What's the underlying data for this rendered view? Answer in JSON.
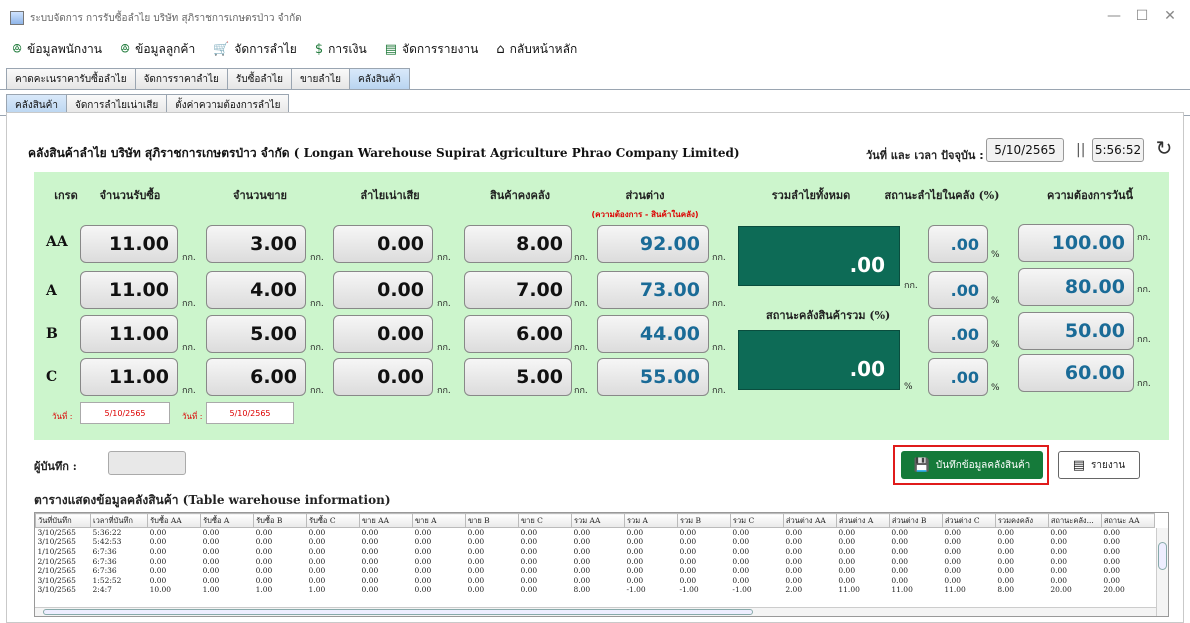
{
  "window": {
    "title": "ระบบจัดการ การรับซื้อลำไย บริษัท สุภิราชการเกษตรป่าว จำกัด"
  },
  "menu": [
    {
      "label": "ข้อมูลพนักงาน",
      "icon": "people-icon"
    },
    {
      "label": "ข้อมูลลูกค้า",
      "icon": "people-icon"
    },
    {
      "label": "จัดการลำไย",
      "icon": "cart-icon"
    },
    {
      "label": "การเงิน",
      "icon": "dollar-icon"
    },
    {
      "label": "จัดการรายงาน",
      "icon": "document-icon"
    },
    {
      "label": "กลับหน้าหลัก",
      "icon": "home-icon"
    }
  ],
  "tabs_main": [
    "คาดคะเนราคารับซื้อลำไย",
    "จัดการราคาลำไย",
    "รับซื้อลำไย",
    "ขายลำไย",
    "คลังสินค้า"
  ],
  "tabs_sub": [
    "คลังสินค้า",
    "จัดการลำไยเน่าเสีย",
    "ตั้งค่าความต้องการลำไย"
  ],
  "heading": "คลังสินค้าลำไย บริษัท สุภิราชการเกษตรป่าว จำกัด ( Longan Warehouse Supirat Agriculture Phrao Company Limited)",
  "datetime": {
    "label": "วันที่ และ เวลา ปัจจุบัน :",
    "date": "5/10/2565",
    "time": "5:56:52",
    "separator": "||"
  },
  "columns": {
    "grade": "เกรด",
    "purchase": "จำนวนรับซื้อ",
    "sold": "จำนวนขาย",
    "spoiled": "ลำไยเน่าเสีย",
    "stock": "สินค้าคงคลัง",
    "diff": "ส่วนต่าง",
    "diff_note": "(ความต้องการ - สินค้าในคลัง)",
    "total": "รวมลำไยทั้งหมด",
    "status": "สถานะลำไยในคลัง (%)",
    "demand": "ความต้องการวันนี้"
  },
  "unit": "กก.",
  "percent": "%",
  "grades": [
    {
      "grade": "AA",
      "purchase": "11.00",
      "sold": "3.00",
      "spoiled": "0.00",
      "stock": "8.00",
      "diff": "92.00",
      "status": ".00",
      "demand": "100.00"
    },
    {
      "grade": "A",
      "purchase": "11.00",
      "sold": "4.00",
      "spoiled": "0.00",
      "stock": "7.00",
      "diff": "73.00",
      "status": ".00",
      "demand": "80.00"
    },
    {
      "grade": "B",
      "purchase": "11.00",
      "sold": "5.00",
      "spoiled": "0.00",
      "stock": "6.00",
      "diff": "44.00",
      "status": ".00",
      "demand": "50.00"
    },
    {
      "grade": "C",
      "purchase": "11.00",
      "sold": "6.00",
      "spoiled": "0.00",
      "stock": "5.00",
      "diff": "55.00",
      "status": ".00",
      "demand": "60.00"
    }
  ],
  "total_value": ".00",
  "overall_label": "สถานะคลังสินค้ารวม (%)",
  "overall_value": ".00",
  "date_rows": {
    "label1": "วันที่ :",
    "date1": "5/10/2565",
    "label2": "วันที่ :",
    "date2": "5/10/2565"
  },
  "recorder_label": "ผู้บันทึก :",
  "buttons": {
    "save": "บันทึกข้อมูลคลังสินค้า",
    "report": "รายงาน"
  },
  "table": {
    "caption": "ตารางแสดงข้อมูลคลังสินค้า (Table warehouse information)",
    "headers": [
      "วันที่บันทึก",
      "เวลาที่บันทึก",
      "รับซื้อ AA",
      "รับซื้อ A",
      "รับซื้อ B",
      "รับซื้อ C",
      "ขาย AA",
      "ขาย A",
      "ขาย B",
      "ขาย C",
      "รวม AA",
      "รวม A",
      "รวม B",
      "รวม C",
      "ส่วนต่าง AA",
      "ส่วนต่าง A",
      "ส่วนต่าง B",
      "ส่วนต่าง C",
      "รวมคงคลัง",
      "สถานะคลัง...",
      "สถานะ AA"
    ],
    "rows": [
      [
        "3/10/2565",
        "5:36:22",
        "0.00",
        "0.00",
        "0.00",
        "0.00",
        "0.00",
        "0.00",
        "0.00",
        "0.00",
        "0.00",
        "0.00",
        "0.00",
        "0.00",
        "0.00",
        "0.00",
        "0.00",
        "0.00",
        "0.00",
        "0.00",
        "0.00"
      ],
      [
        "3/10/2565",
        "5:42:53",
        "0.00",
        "0.00",
        "0.00",
        "0.00",
        "0.00",
        "0.00",
        "0.00",
        "0.00",
        "0.00",
        "0.00",
        "0.00",
        "0.00",
        "0.00",
        "0.00",
        "0.00",
        "0.00",
        "0.00",
        "0.00",
        "0.00"
      ],
      [
        "1/10/2565",
        "6:7:36",
        "0.00",
        "0.00",
        "0.00",
        "0.00",
        "0.00",
        "0.00",
        "0.00",
        "0.00",
        "0.00",
        "0.00",
        "0.00",
        "0.00",
        "0.00",
        "0.00",
        "0.00",
        "0.00",
        "0.00",
        "0.00",
        "0.00"
      ],
      [
        "2/10/2565",
        "6:7:36",
        "0.00",
        "0.00",
        "0.00",
        "0.00",
        "0.00",
        "0.00",
        "0.00",
        "0.00",
        "0.00",
        "0.00",
        "0.00",
        "0.00",
        "0.00",
        "0.00",
        "0.00",
        "0.00",
        "0.00",
        "0.00",
        "0.00"
      ],
      [
        "2/10/2565",
        "6:7:36",
        "0.00",
        "0.00",
        "0.00",
        "0.00",
        "0.00",
        "0.00",
        "0.00",
        "0.00",
        "0.00",
        "0.00",
        "0.00",
        "0.00",
        "0.00",
        "0.00",
        "0.00",
        "0.00",
        "0.00",
        "0.00",
        "0.00"
      ],
      [
        "3/10/2565",
        "1:52:52",
        "0.00",
        "0.00",
        "0.00",
        "0.00",
        "0.00",
        "0.00",
        "0.00",
        "0.00",
        "0.00",
        "0.00",
        "0.00",
        "0.00",
        "0.00",
        "0.00",
        "0.00",
        "0.00",
        "0.00",
        "0.00",
        "0.00"
      ],
      [
        "3/10/2565",
        "2:4:7",
        "10.00",
        "1.00",
        "1.00",
        "1.00",
        "0.00",
        "0.00",
        "0.00",
        "0.00",
        "8.00",
        "-1.00",
        "-1.00",
        "-1.00",
        "2.00",
        "11.00",
        "11.00",
        "11.00",
        "8.00",
        "20.00",
        "20.00"
      ]
    ]
  },
  "colors": {
    "panel_green": "#ccf5cc",
    "dark_teal": "#0d6b56",
    "save_green": "#157a3a",
    "highlight_red": "#e01b1b",
    "value_blue": "#1a6b97"
  }
}
